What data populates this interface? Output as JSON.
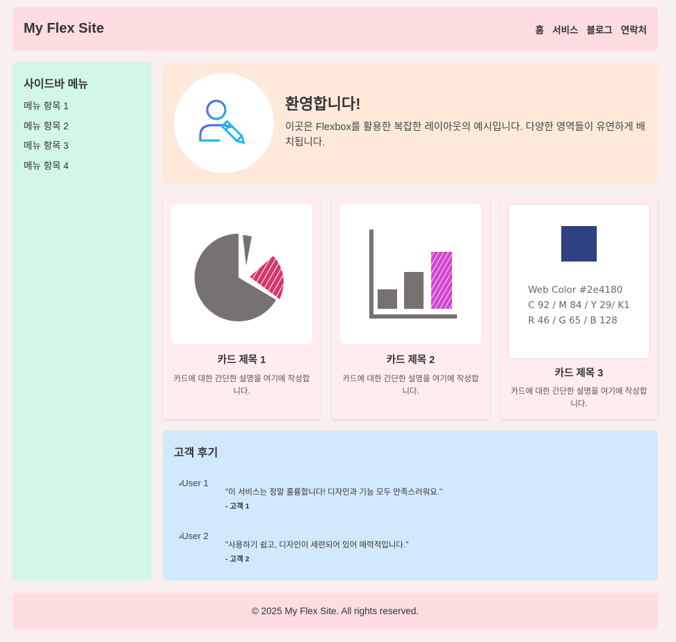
{
  "header": {
    "site_title": "My Flex Site",
    "nav": [
      "홈",
      "서비스",
      "블로그",
      "연락처"
    ]
  },
  "sidebar": {
    "title": "사이드바 메뉴",
    "items": [
      "메뉴 항목 1",
      "메뉴 항목 2",
      "메뉴 항목 3",
      "메뉴 항목 4"
    ]
  },
  "welcome": {
    "title": "환영합니다!",
    "text": "이곳은 Flexbox를 활용한 복잡한 레이아웃의 예시입니다. 다양한 영역들이 유연하게 배치됩니다.",
    "icon": "user-edit-icon"
  },
  "cards": [
    {
      "title": "카드 제목 1",
      "text": "카드에 대한 간단한 설명을 여기에 작성합니다.",
      "image": "pie-chart-icon"
    },
    {
      "title": "카드 제목 2",
      "text": "카드에 대한 간단한 설명을 여기에 작성합니다.",
      "image": "bar-chart-icon"
    },
    {
      "title": "카드 제목 3",
      "text": "카드에 대한 간단한 설명을 여기에 작성합니다.",
      "image": "color-swatch"
    }
  ],
  "color_swatch": {
    "color": "#2e4180",
    "line1": "Web Color #2e4180",
    "line2": "C 92 / M 84 / Y 29/ K1",
    "line3": "R 46 / G 65 / B 128"
  },
  "reviews": {
    "title": "고객 후기",
    "items": [
      {
        "img_alt": "User 1",
        "quote": "\"이 서비스는 정말 훌륭합니다! 디자인과 기능 모두 만족스러워요.\"",
        "author": "- 고객 1"
      },
      {
        "img_alt": "User 2",
        "quote": "\"사용하기 쉽고, 디자인이 세련되어 있어 매력적입니다.\"",
        "author": "- 고객 2"
      }
    ]
  },
  "footer": {
    "text": "© 2025 My Flex Site. All rights reserved."
  },
  "colors": {
    "background": "#f9efee",
    "header": "#fedde1",
    "sidebar": "#d3f7e6",
    "welcome": "#fee9da",
    "card": "#feecef",
    "reviews": "#d2e9fd",
    "pie_accent": "#d1386a",
    "bar_accent": "#d046d0",
    "chart_gray": "#767272"
  }
}
